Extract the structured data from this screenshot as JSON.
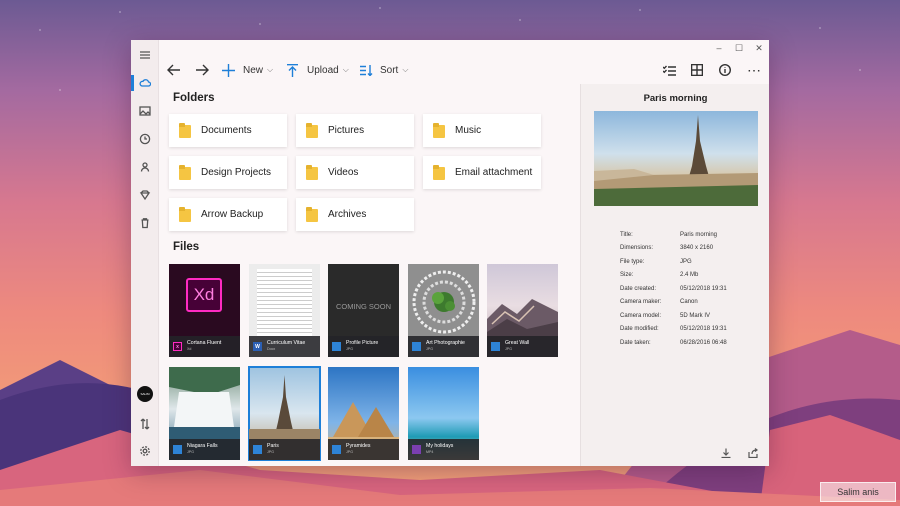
{
  "window": {
    "controls": {
      "minimize": "–",
      "maximize": "☐",
      "close": "✕"
    }
  },
  "toolbar": {
    "new_label": "New",
    "upload_label": "Upload",
    "sort_label": "Sort"
  },
  "main": {
    "folders_heading": "Folders",
    "files_heading": "Files",
    "folders": [
      "Documents",
      "Pictures",
      "Music",
      "Design Projects",
      "Videos",
      "Email attachment",
      "Arrow Backup",
      "Archives"
    ],
    "files": [
      {
        "name": "Cortana Fluent",
        "type": "Xd"
      },
      {
        "name": "Curriculum Vitae",
        "type": "Docx"
      },
      {
        "name": "Profile Picture",
        "type": "JPG"
      },
      {
        "name": "Art Photographie",
        "type": "JPG"
      },
      {
        "name": "Great Wall",
        "type": "JPG"
      },
      {
        "name": "Niagara Falls",
        "type": "JPG"
      },
      {
        "name": "Paris",
        "type": "JPG"
      },
      {
        "name": "Pyramides",
        "type": "JPG"
      },
      {
        "name": "My holidays",
        "type": "MP4"
      }
    ],
    "xd_logo": "Xd",
    "coming_soon": "COMING SOON"
  },
  "details": {
    "title": "Paris morning",
    "rows": [
      {
        "k": "Title:",
        "v": "Paris morning"
      },
      {
        "k": "Dimensions:",
        "v": "3840 x 2160"
      },
      {
        "k": "File type:",
        "v": "JPG"
      },
      {
        "k": "Size:",
        "v": "2.4 Mb"
      },
      {
        "k": "Date created:",
        "v": "05/12/2018 19:31"
      },
      {
        "k": "Camera maker:",
        "v": "Canon"
      },
      {
        "k": "Camera model:",
        "v": "5D Mark IV"
      },
      {
        "k": "Date modified:",
        "v": "05/12/2018 19:31"
      },
      {
        "k": "Date taken:",
        "v": "06/28/2016 06:48"
      }
    ]
  },
  "user": {
    "avatar_text": "SALIM"
  },
  "taskbar": {
    "user_label": "Salim anis"
  },
  "colors": {
    "accent": "#1e7fd8",
    "folder": "#f5c542"
  }
}
